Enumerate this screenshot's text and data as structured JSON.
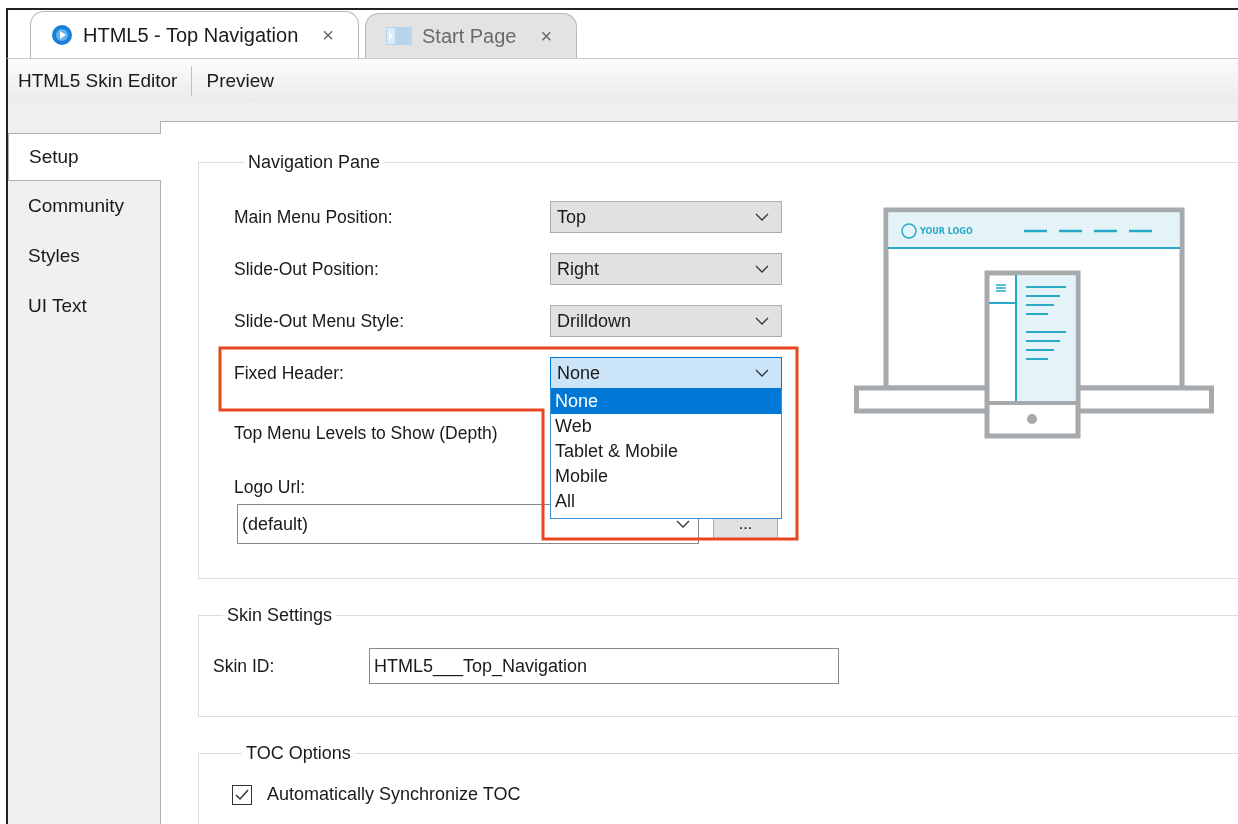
{
  "tabs": [
    {
      "label": "HTML5 - Top Navigation",
      "selected": true,
      "close": "×"
    },
    {
      "label": "Start Page",
      "selected": false,
      "close": "×"
    }
  ],
  "toolbar": [
    {
      "label": "HTML5 Skin Editor"
    },
    {
      "label": "Preview"
    }
  ],
  "side_tabs": [
    {
      "label": "Setup",
      "selected": true
    },
    {
      "label": "Community",
      "selected": false
    },
    {
      "label": "Styles",
      "selected": false
    },
    {
      "label": "UI Text",
      "selected": false
    }
  ],
  "navigation_pane": {
    "title": "Navigation Pane",
    "fields": [
      {
        "kind": "combo",
        "label": "Main Menu Position:",
        "value": "Top",
        "focused": false
      },
      {
        "kind": "combo",
        "label": "Slide-Out Position:",
        "value": "Right",
        "focused": false
      },
      {
        "kind": "combo",
        "label": "Slide-Out Menu Style:",
        "value": "Drilldown",
        "focused": false
      },
      {
        "kind": "combo",
        "label": "Fixed Header:",
        "value": "None",
        "focused": true,
        "highlighted": true,
        "options": [
          {
            "label": "None",
            "selected": true
          },
          {
            "label": "Web",
            "selected": false
          },
          {
            "label": "Tablet & Mobile",
            "selected": false
          },
          {
            "label": "Mobile",
            "selected": false
          },
          {
            "label": "All",
            "selected": false
          }
        ]
      },
      {
        "kind": "label",
        "label": "Top Menu Levels to Show (Depth)"
      },
      {
        "kind": "wide-combo",
        "label": "Logo Url:",
        "value": "(default)",
        "button": "..."
      }
    ],
    "preview": {
      "logo_text": "YOUR LOGO"
    }
  },
  "skin_settings": {
    "title": "Skin Settings",
    "label": "Skin ID:",
    "value": "HTML5___Top_Navigation"
  },
  "toc_options": {
    "title": "TOC Options",
    "checkbox": {
      "label": "Automatically Synchronize TOC",
      "checked": true
    }
  }
}
